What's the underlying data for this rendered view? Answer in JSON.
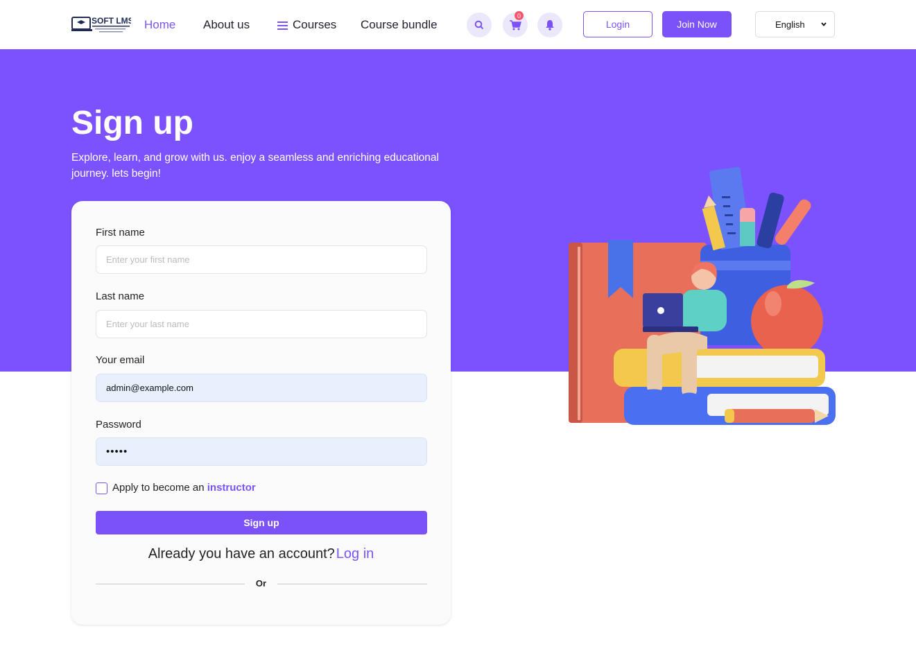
{
  "header": {
    "logo_text": "SOFT LMS",
    "nav": {
      "home": "Home",
      "about": "About us",
      "courses": "Courses",
      "bundle": "Course bundle"
    },
    "cart_count": "0",
    "login_label": "Login",
    "join_label": "Join Now",
    "language": "English"
  },
  "hero": {
    "title": "Sign up",
    "subtitle": "Explore, learn, and grow with us. enjoy a seamless and enriching educational journey. lets begin!"
  },
  "form": {
    "first_name_label": "First name",
    "first_name_placeholder": "Enter your first name",
    "last_name_label": "Last name",
    "last_name_placeholder": "Enter your last name",
    "email_label": "Your email",
    "email_value": "admin@example.com",
    "password_label": "Password",
    "password_value": "•••••",
    "instructor_text": "Apply to become an",
    "instructor_link": "instructor",
    "signup_label": "Sign up",
    "already_text": "Already you have an account?",
    "login_link": "Log in",
    "or_text": "Or"
  },
  "colors": {
    "accent": "#7b52f7",
    "hero_bg": "#7b52fe"
  }
}
